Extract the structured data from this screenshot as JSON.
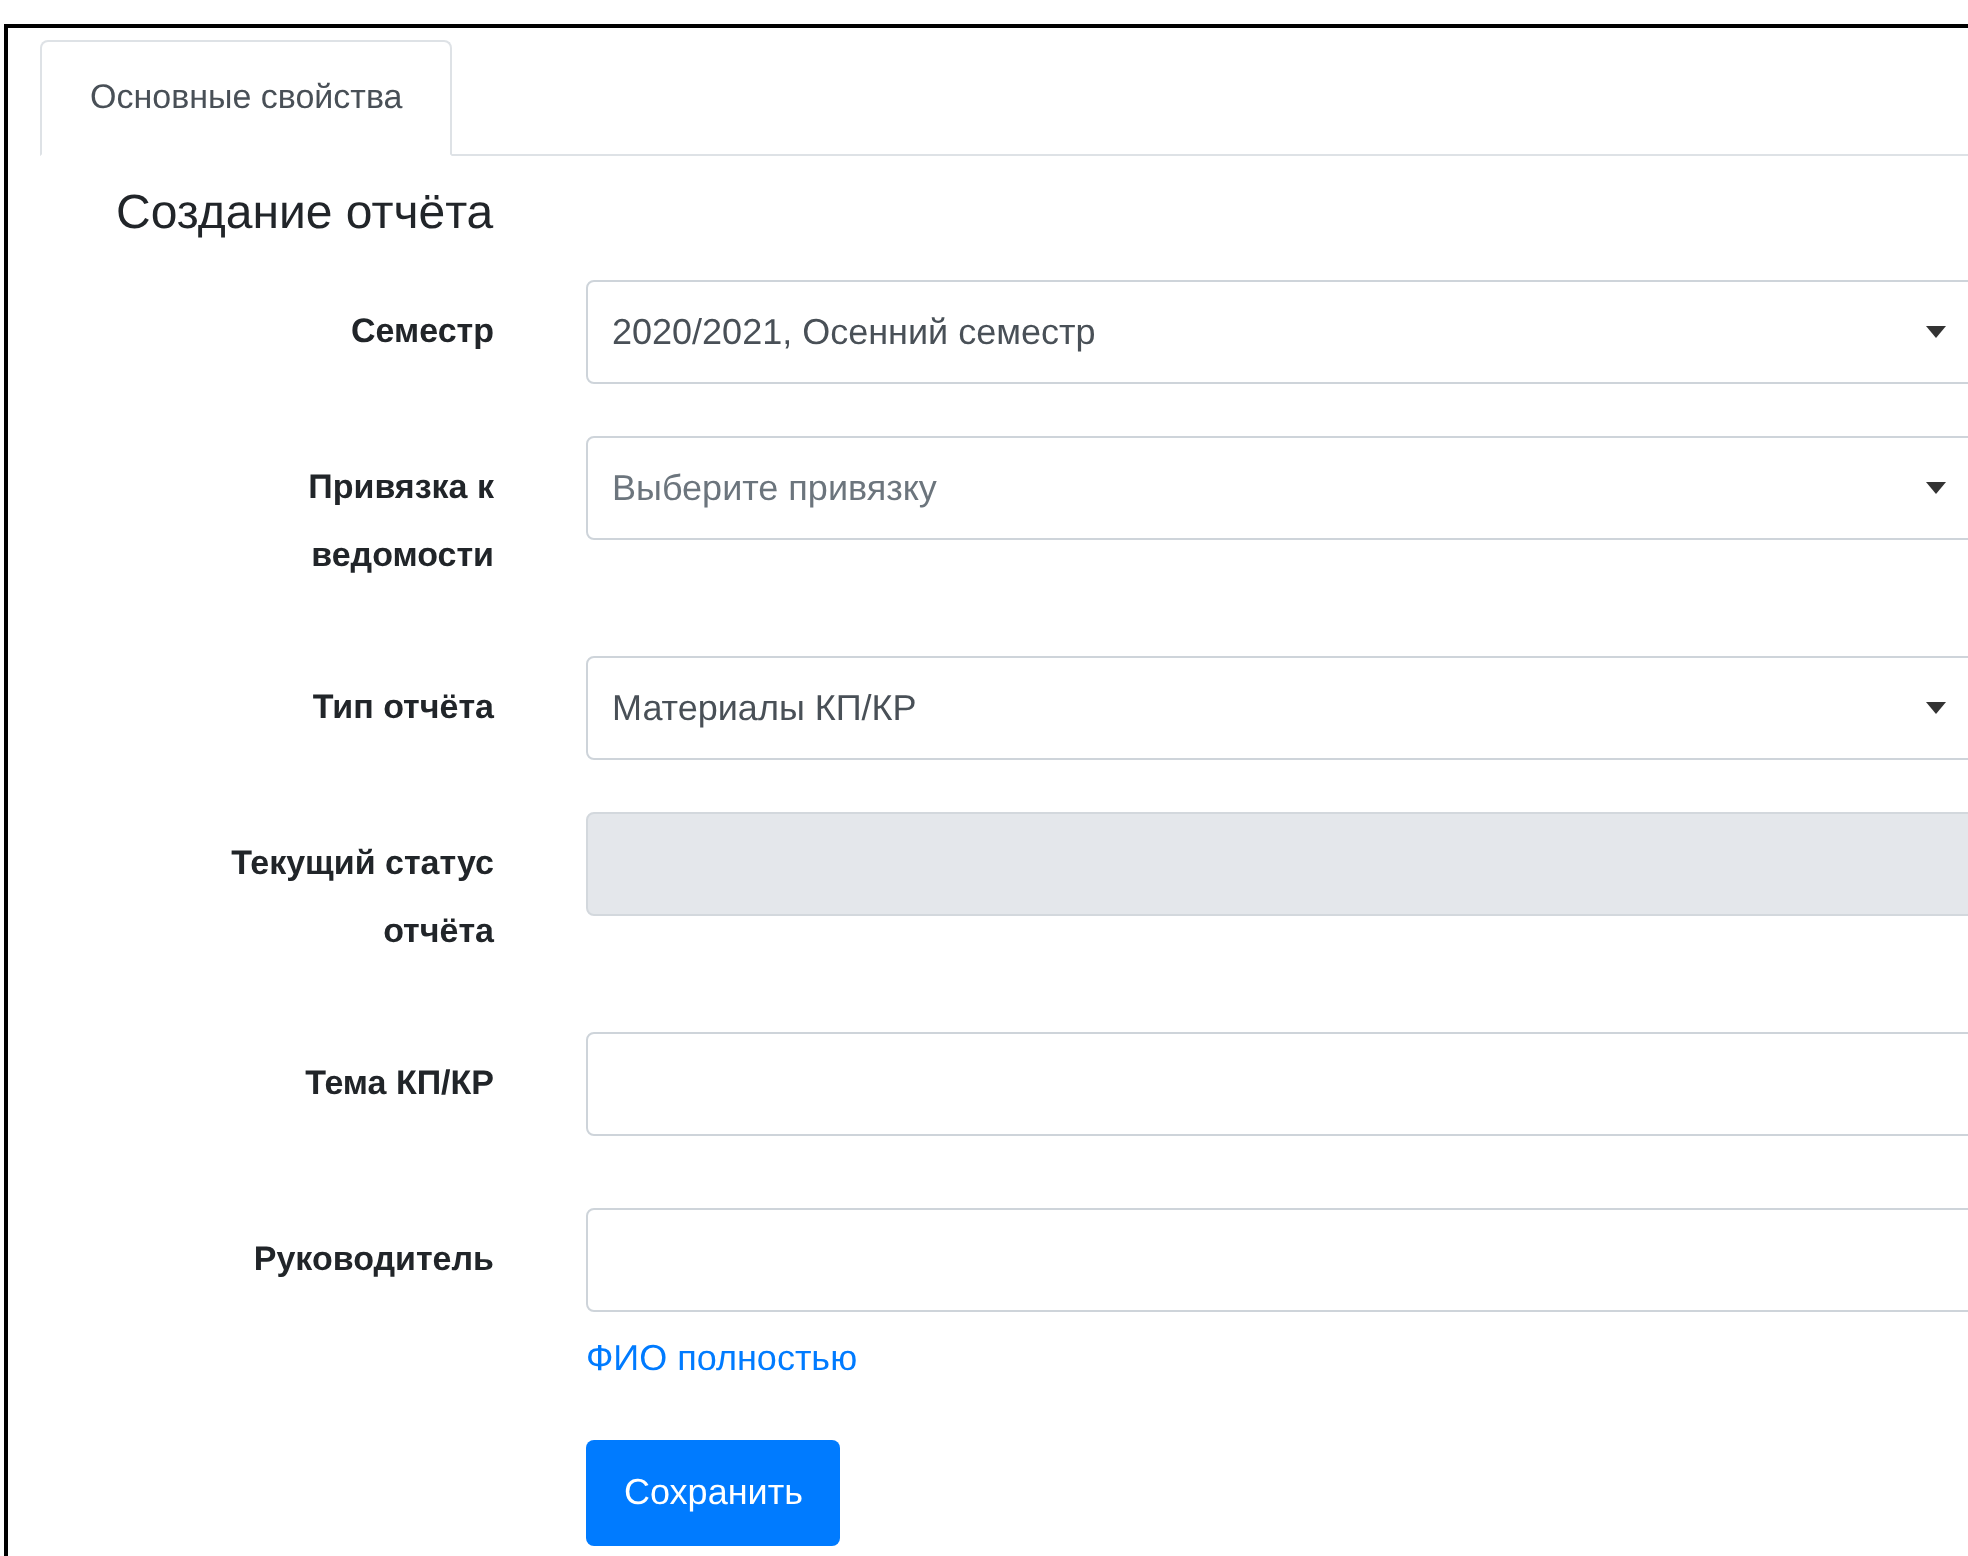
{
  "tabs": [
    {
      "label": "Основные свойства",
      "selected": true
    }
  ],
  "heading": "Создание отчёта",
  "fields": [
    {
      "kind": "select",
      "label": "Семестр",
      "value": "2020/2021, Осенний семестр",
      "disabled": false
    },
    {
      "kind": "select",
      "label": "Привязка к ведомости",
      "placeholder": "Выберите привязку",
      "disabled": false
    },
    {
      "kind": "select",
      "label": "Тип отчёта",
      "value": "Материалы КП/КР",
      "disabled": false
    },
    {
      "kind": "text",
      "label": "Текущий статус отчёта",
      "disabled": true
    },
    {
      "kind": "text",
      "label": "Тема КП/КР",
      "disabled": false
    },
    {
      "kind": "text",
      "label": "Руководитель",
      "disabled": false,
      "help": "ФИО полностью"
    }
  ],
  "submit": "Сохранить"
}
